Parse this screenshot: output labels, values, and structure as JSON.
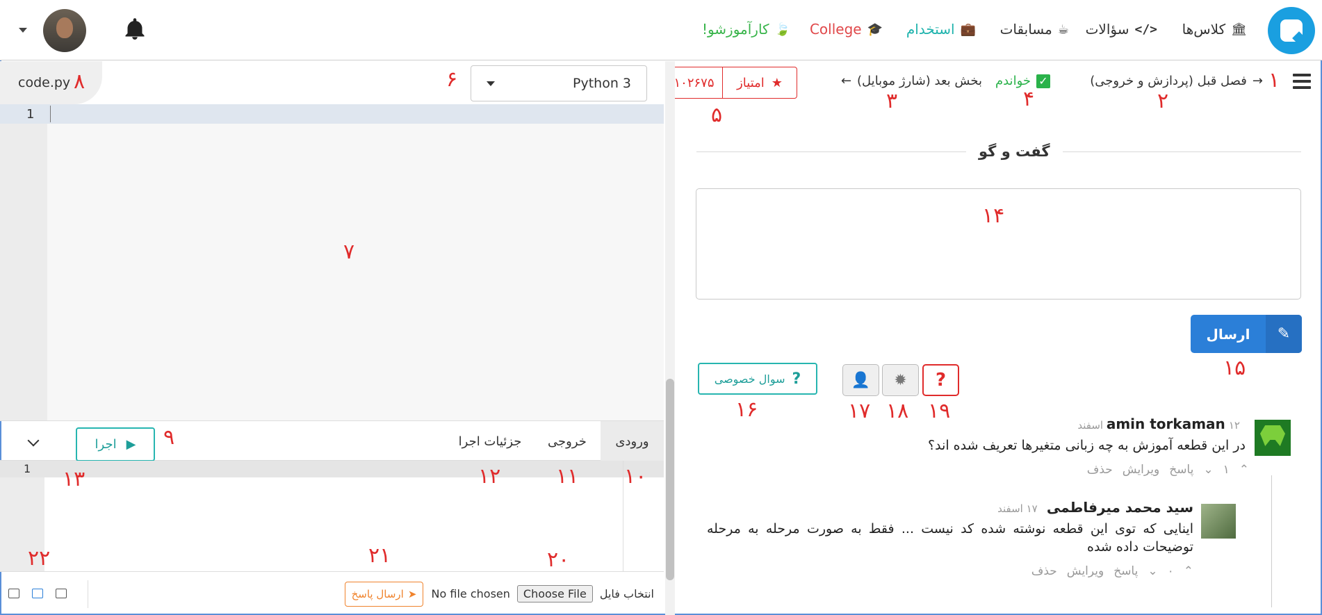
{
  "nav": {
    "classes": "کلاس‌ها",
    "questions": "سؤالات",
    "contests": "مسابقات",
    "hiring": "استخدام",
    "college": "College",
    "internship": "کارآموزشو!"
  },
  "toolbar": {
    "prev": "فصل قبل (پردازش و خروجی)",
    "read": "خواندم",
    "next": "بخش بعد (شارژ موبایل)",
    "score_label": "امتیاز",
    "score_value": "۱۰۲۶۷۵"
  },
  "discussion": {
    "title": "گفت و گو",
    "send": "ارسال",
    "private_question": "سوال خصوصی"
  },
  "comments": [
    {
      "author": "amin torkaman",
      "date": "۱۲ اسفند",
      "body": "در این قطعه آموزش به چه زبانی متغیرها تعریف شده اند؟",
      "votes": "۱",
      "reply": "پاسخ",
      "edit": "ویرایش",
      "delete": "حذف"
    },
    {
      "author": "سید محمد میرفاطمی",
      "date": "۱۷ اسفند",
      "body": "اینایی که توی این قطعه نوشته شده کد نیست ... فقط به صورت مرحله به مرحله توضیحات داده شده",
      "votes": "۰",
      "reply": "پاسخ",
      "edit": "ویرایش",
      "delete": "حذف"
    }
  ],
  "editor": {
    "filename": "code.py",
    "language": "Python 3",
    "line_number": "1"
  },
  "io": {
    "input_tab": "ورودی",
    "output_tab": "خروجی",
    "details_tab": "جزئیات اجرا",
    "run": "اجرا",
    "input_line": "1"
  },
  "bottom": {
    "choose_file_label": "انتخاب فایل",
    "choose_file_button": "Choose File",
    "no_file": "No file chosen",
    "submit": "ارسال پاسخ"
  },
  "annotations": [
    "۱",
    "۲",
    "۳",
    "۴",
    "۵",
    "۶",
    "۷",
    "۸",
    "۹",
    "۱۰",
    "۱۱",
    "۱۲",
    "۱۳",
    "۱۴",
    "۱۵",
    "۱۶",
    "۱۷",
    "۱۸",
    "۱۹",
    "۲۰",
    "۲۱",
    "۲۲"
  ],
  "colors": {
    "accent_blue": "#2b7fd8",
    "teal": "#1d9e99",
    "red": "#e02b2b",
    "orange": "#f0832c",
    "green": "#2ab24a"
  }
}
